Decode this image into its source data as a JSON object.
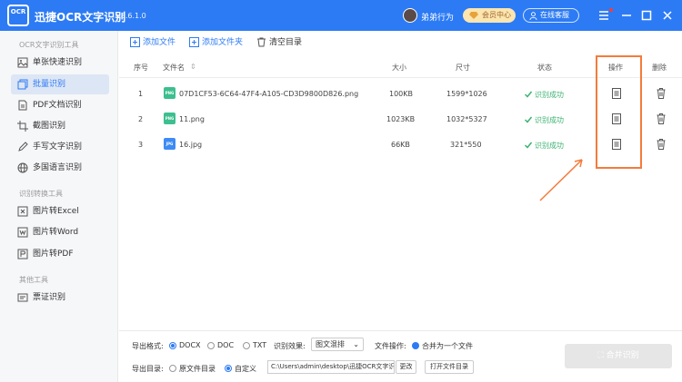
{
  "app": {
    "logo_text": "OCR",
    "name": "迅捷OCR文字识别",
    "version": "v8.6.1.0",
    "username": "弟弟行为",
    "vip_label": "会员中心",
    "service_label": "在线客服"
  },
  "sidebar": {
    "sections": [
      {
        "title": "OCR文字识别工具",
        "items": [
          {
            "label": "单张快速识别",
            "icon": "single-image-icon"
          },
          {
            "label": "批量识别",
            "icon": "batch-icon",
            "active": true
          },
          {
            "label": "PDF文档识别",
            "icon": "pdf-icon"
          },
          {
            "label": "截图识别",
            "icon": "screenshot-icon"
          },
          {
            "label": "手写文字识别",
            "icon": "handwriting-icon"
          },
          {
            "label": "多国语言识别",
            "icon": "globe-icon"
          }
        ]
      },
      {
        "title": "识别转换工具",
        "items": [
          {
            "label": "图片转Excel",
            "icon": "excel-icon"
          },
          {
            "label": "图片转Word",
            "icon": "word-icon"
          },
          {
            "label": "图片转PDF",
            "icon": "pdf-convert-icon"
          }
        ]
      },
      {
        "title": "其他工具",
        "items": [
          {
            "label": "票证识别",
            "icon": "ticket-icon"
          }
        ]
      }
    ]
  },
  "toolbar": {
    "add_file": "添加文件",
    "add_folder": "添加文件夹",
    "clear_list": "清空目录"
  },
  "table": {
    "headers": {
      "index": "序号",
      "filename": "文件名",
      "sort_icon": "⇕",
      "size": "大小",
      "dimensions": "尺寸",
      "status": "状态",
      "operation": "操作",
      "delete": "删除"
    },
    "rows": [
      {
        "index": "1",
        "type": "PNG",
        "filename": "07D1CF53-6C64-47F4-A105-CD3D9800D826.png",
        "size": "100KB",
        "dimensions": "1599*1026",
        "status": "识别成功"
      },
      {
        "index": "2",
        "type": "PNG",
        "filename": "11.png",
        "size": "1023KB",
        "dimensions": "1032*5327",
        "status": "识别成功"
      },
      {
        "index": "3",
        "type": "JPG",
        "filename": "16.jpg",
        "size": "66KB",
        "dimensions": "321*550",
        "status": "识别成功"
      }
    ]
  },
  "bottom": {
    "export_format_label": "导出格式:",
    "formats": [
      "DOCX",
      "DOC",
      "TXT"
    ],
    "selected_format": "DOCX",
    "effect_label": "识别效果:",
    "effect_value": "图文混排",
    "file_op_label": "文件操作:",
    "merge_option": "合并为一个文件",
    "export_dir_label": "导出目录:",
    "dir_original": "原文件目录",
    "dir_custom": "自定义",
    "path_value": "C:\\Users\\admin\\desktop\\迅捷OCR文字识别",
    "change_btn": "更改",
    "open_folder_btn": "打开文件目录",
    "merge_btn": "合并识别"
  },
  "colors": {
    "primary": "#2d7bf4",
    "success": "#3cb371",
    "highlight": "#f47b3b",
    "png_icon": "#3dbf8f",
    "jpg_icon": "#3d8bf4"
  }
}
